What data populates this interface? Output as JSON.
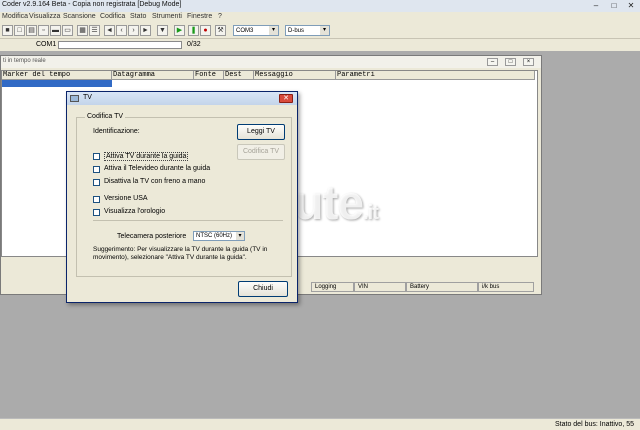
{
  "window": {
    "title": "Coder v2.9.164 Beta - Copia non registrata [Debug Mode]"
  },
  "menu": [
    "Modifica",
    "Visualizza",
    "Scansione",
    "Codifica",
    "Stato",
    "Strumenti",
    "Finestre",
    "?"
  ],
  "toolbar": {
    "port": "COM3",
    "bus": "D-bus"
  },
  "statusrow": {
    "port_label": "COM1",
    "progress": "0/32"
  },
  "child_window": {
    "title": "ti in tempo reale",
    "columns": [
      "Marker del tempo",
      "Datagramma",
      "Fonte",
      "Dest",
      "Messaggio",
      "Parametri"
    ],
    "status_cells": [
      "Logging",
      "VIN",
      "Battery",
      "i/k bus"
    ]
  },
  "dialog": {
    "title": "TV",
    "group_label": "Codifica TV",
    "identification_label": "Identificazione:",
    "read_button": "Leggi TV",
    "encode_button": "Codifica TV",
    "options": [
      "Attiva TV durante la guida",
      "Attiva il Televideo durante la guida",
      "Disattiva la TV con freno a mano",
      "Versione USA",
      "Visualizza l'orologio"
    ],
    "rear_camera_label": "Telecamera posteriore",
    "rear_camera_value": "NTSC (60Hz)",
    "hint": "Suggerimento: Per visualizzare la TV durante la guida (TV in movimento), selezionare \"Attiva TV durante la guida\".",
    "close_button": "Chiudi"
  },
  "bottom_status": "Stato del bus: Inattivo, 55",
  "watermark": {
    "main": "Permute",
    "suffix": ".it"
  }
}
